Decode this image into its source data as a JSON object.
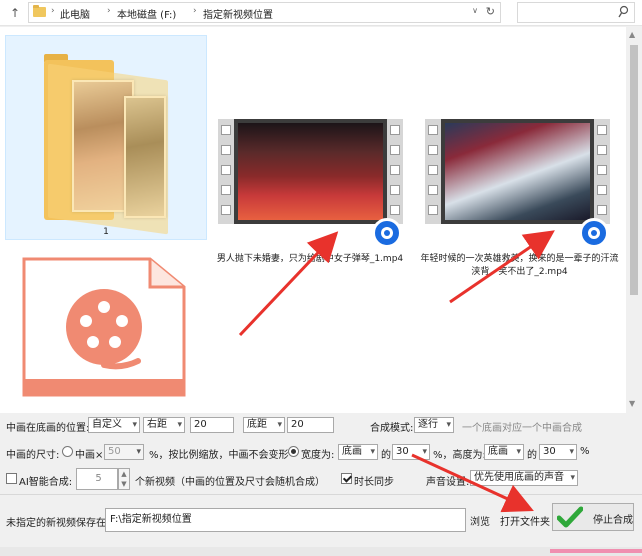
{
  "address": {
    "crumbs": [
      "此电脑",
      "本地磁盘 (F:)",
      "指定新视频位置"
    ]
  },
  "search": {
    "placeholder": ""
  },
  "files": [
    {
      "label": "1",
      "kind": "folder"
    },
    {
      "label": "男人抛下未婚妻，只为给剧中女子弹琴_1.mp4",
      "kind": "video"
    },
    {
      "label": "年轻时候的一次英雄救美，换来的是一辈子的汗流浃背，笑不出了_2.mp4",
      "kind": "video"
    },
    {
      "label": "",
      "kind": "video-doc"
    }
  ],
  "icons": {
    "folder": "folder-icon",
    "video_badge": "player-badge-icon",
    "doc": "video-file-icon",
    "accent": "#f08a72",
    "arrow": "#e8322c"
  },
  "panel": {
    "position_label": "中画在底画的位置:",
    "position_mode": "自定义",
    "align_h": "右距",
    "align_h_value": "20",
    "align_v": "底距",
    "align_v_value": "20",
    "synth_label": "合成模式:",
    "synth_mode": "逐行",
    "synth_hint": "一个底画对应一个中画合成",
    "size_label": "中画的尺寸:",
    "size_option1": "中画×",
    "size_scale": "50",
    "size_option1_suffix": "%，按比例缩放，中画不会变形",
    "size_option2": "宽度为:",
    "width_ref": "底画",
    "width_of": "的",
    "width_pct": "30",
    "height_label": "%，高度为:",
    "height_ref": "底画",
    "height_of": "的",
    "height_pct": "30",
    "percent": "%",
    "ai_label": "AI智能合成:",
    "ai_count": "5",
    "ai_suffix": "个新视频（中画的位置及尺寸会随机合成）",
    "sync_label": "时长同步",
    "sound_label": "声音设置:",
    "sound_mode": "优先使用底画的声音",
    "save_label": "未指定的新视频保存在:",
    "save_path": "F:\\指定新视频位置",
    "browse": "浏览",
    "open_folder": "打开文件夹",
    "stop": "停止合成"
  }
}
